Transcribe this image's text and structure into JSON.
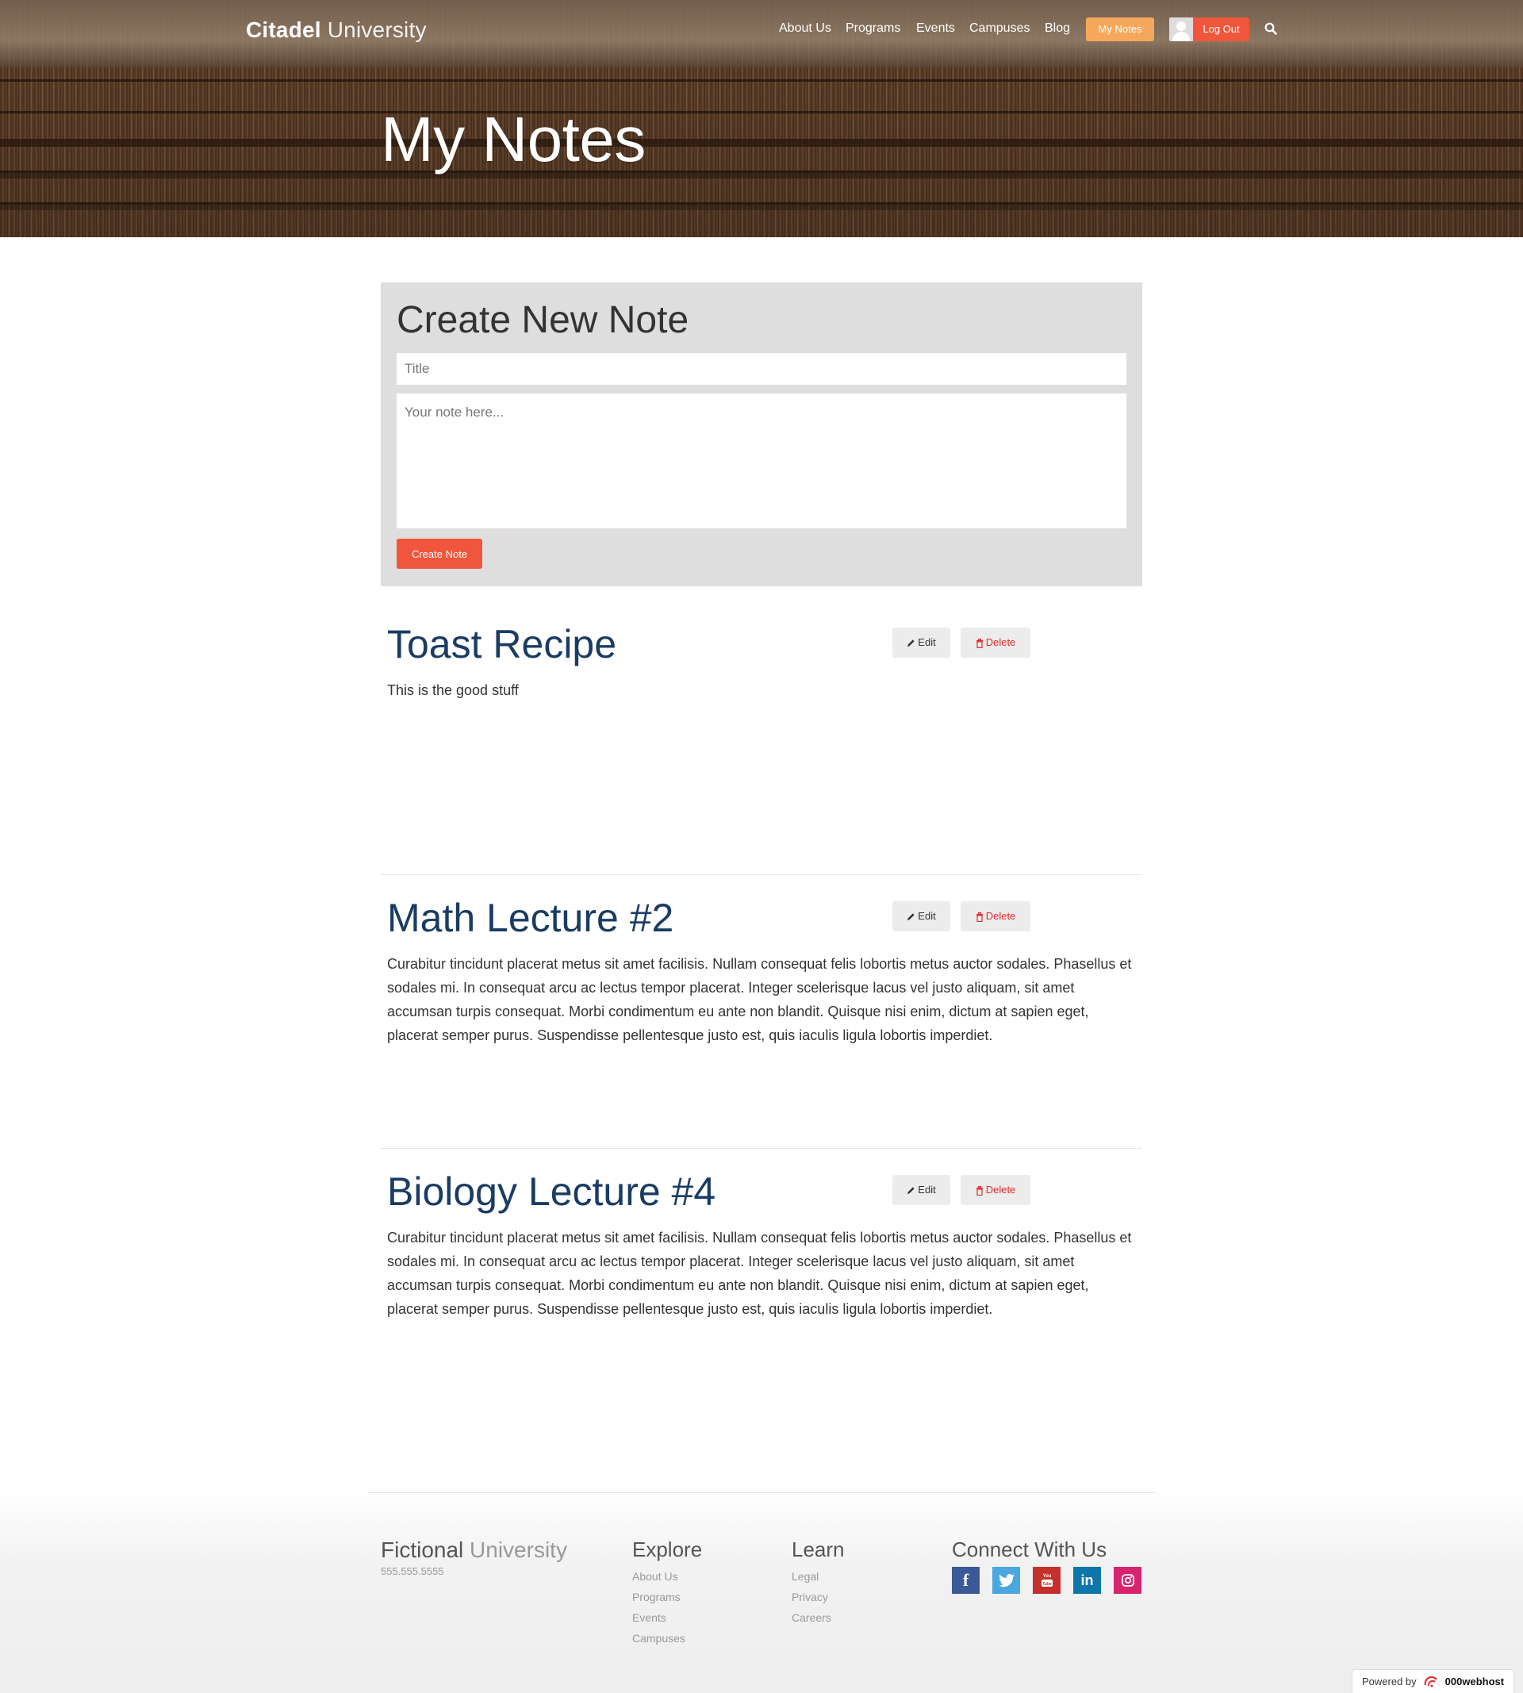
{
  "header": {
    "brand_bold": "Citadel",
    "brand_light": " University",
    "nav": [
      "About Us",
      "Programs",
      "Events",
      "Campuses",
      "Blog"
    ],
    "my_notes_label": "My Notes",
    "logout_label": "Log Out"
  },
  "hero": {
    "title": "My Notes"
  },
  "create": {
    "heading": "Create New Note",
    "title_placeholder": "Title",
    "body_placeholder": "Your note here...",
    "button_label": "Create Note"
  },
  "notes": [
    {
      "title": "Toast Recipe",
      "body": "This is the good stuff",
      "edit_label": "Edit",
      "delete_label": "Delete"
    },
    {
      "title": "Math Lecture #2",
      "body": "Curabitur tincidunt placerat metus sit amet facilisis. Nullam consequat felis lobortis metus auctor sodales. Phasellus et sodales mi. In consequat arcu ac lectus tempor placerat. Integer scelerisque lacus vel justo aliquam, sit amet accumsan turpis consequat. Morbi condimentum eu ante non blandit. Quisque nisi enim, dictum at sapien eget, placerat semper purus. Suspendisse pellentesque justo est, quis iaculis ligula lobortis imperdiet.",
      "edit_label": "Edit",
      "delete_label": "Delete"
    },
    {
      "title": "Biology Lecture #4",
      "body": "Curabitur tincidunt placerat metus sit amet facilisis. Nullam consequat felis lobortis metus auctor sodales. Phasellus et sodales mi. In consequat arcu ac lectus tempor placerat. Integer scelerisque lacus vel justo aliquam, sit amet accumsan turpis consequat. Morbi condimentum eu ante non blandit. Quisque nisi enim, dictum at sapien eget, placerat semper purus. Suspendisse pellentesque justo est, quis iaculis ligula lobortis imperdiet.",
      "edit_label": "Edit",
      "delete_label": "Delete"
    }
  ],
  "footer": {
    "brand_bold": "Fictional",
    "brand_light": " University",
    "phone": "555.555.5555",
    "explore": {
      "heading": "Explore",
      "links": [
        "About Us",
        "Programs",
        "Events",
        "Campuses"
      ]
    },
    "learn": {
      "heading": "Learn",
      "links": [
        "Legal",
        "Privacy",
        "Careers"
      ]
    },
    "connect": {
      "heading": "Connect With Us",
      "icons": [
        {
          "name": "facebook-icon",
          "glyph": "f",
          "color": "#3b5998"
        },
        {
          "name": "twitter-icon",
          "glyph": "t",
          "color": "#4aa7e0"
        },
        {
          "name": "youtube-icon",
          "glyph": "▶",
          "color": "#c4302b"
        },
        {
          "name": "linkedin-icon",
          "glyph": "in",
          "color": "#0e76a8"
        },
        {
          "name": "instagram-icon",
          "glyph": "◎",
          "color": "#d6246e"
        }
      ]
    },
    "powered_by": "Powered by",
    "powered_brand": "000webhost"
  }
}
